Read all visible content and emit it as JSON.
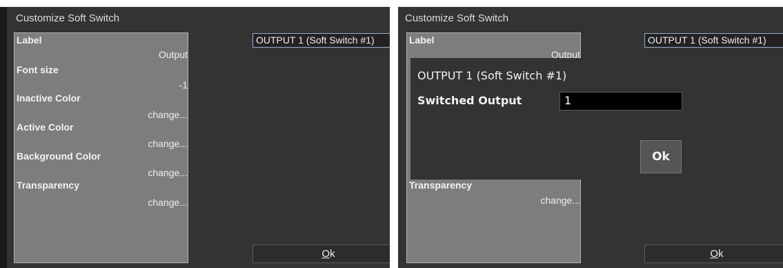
{
  "left_dialog": {
    "title": "Customize Soft Switch",
    "properties": [
      {
        "name": "Label",
        "value": "Output"
      },
      {
        "name": "Font size",
        "value": "-1"
      },
      {
        "name": "Inactive Color",
        "value": "change..."
      },
      {
        "name": "Active Color",
        "value": "change..."
      },
      {
        "name": "Background Color",
        "value": "change..."
      },
      {
        "name": "Transparency",
        "value": "change..."
      }
    ],
    "output_select": "OUTPUT 1 (Soft Switch #1)",
    "ok_button": {
      "underlined": "O",
      "rest": "k"
    }
  },
  "right_dialog": {
    "title": "Customize Soft Switch",
    "properties": [
      {
        "name": "Label",
        "value": "Output"
      },
      {
        "name": "Transparency",
        "value": "change..."
      }
    ],
    "output_select": "OUTPUT 1 (Soft Switch #1)",
    "ok_button": {
      "underlined": "O",
      "rest": "k"
    },
    "popup": {
      "title": "OUTPUT 1 (Soft Switch #1)",
      "field_label": "Switched Output",
      "field_value": "1",
      "ok_label": "Ok"
    }
  }
}
